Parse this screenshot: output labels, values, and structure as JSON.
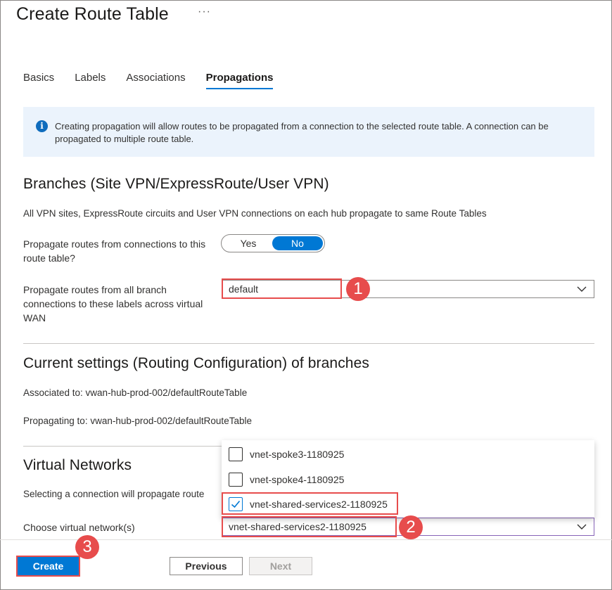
{
  "header": {
    "title": "Create Route Table",
    "more_label": "···"
  },
  "tabs": [
    {
      "label": "Basics",
      "active": false
    },
    {
      "label": "Labels",
      "active": false
    },
    {
      "label": "Associations",
      "active": false
    },
    {
      "label": "Propagations",
      "active": true
    }
  ],
  "info": {
    "icon": "info-icon",
    "text": "Creating propagation will allow routes to be propagated from a connection to the selected route table. A connection can be propagated to multiple route table."
  },
  "branches": {
    "heading": "Branches (Site VPN/ExpressRoute/User VPN)",
    "description": "All VPN sites, ExpressRoute circuits and User VPN connections on each hub propagate to same Route Tables",
    "propagate_label": "Propagate routes from connections to this route table?",
    "toggle": {
      "yes_label": "Yes",
      "no_label": "No",
      "selected": "No"
    },
    "labels_label": "Propagate routes from all branch connections to these labels across virtual WAN",
    "labels_value": "default"
  },
  "current": {
    "heading": "Current settings (Routing Configuration) of branches",
    "associated": "Associated to: vwan-hub-prod-002/defaultRouteTable",
    "propagating": "Propagating to: vwan-hub-prod-002/defaultRouteTable"
  },
  "vnets": {
    "heading": "Virtual Networks",
    "description": "Selecting a connection will propagate route",
    "choose_label": "Choose virtual network(s)",
    "choose_value": "vnet-shared-services2-1180925",
    "options": [
      {
        "label": "vnet-spoke3-1180925",
        "checked": false
      },
      {
        "label": "vnet-spoke4-1180925",
        "checked": false
      },
      {
        "label": "vnet-shared-services2-1180925",
        "checked": true
      }
    ]
  },
  "annotations": {
    "step1": "1",
    "step2": "2",
    "step3": "3",
    "color": "#e74c4c"
  },
  "footer": {
    "create_label": "Create",
    "previous_label": "Previous",
    "next_label": "Next"
  },
  "colors": {
    "accent": "#0078d4",
    "info_bg": "#ebf3fc"
  }
}
